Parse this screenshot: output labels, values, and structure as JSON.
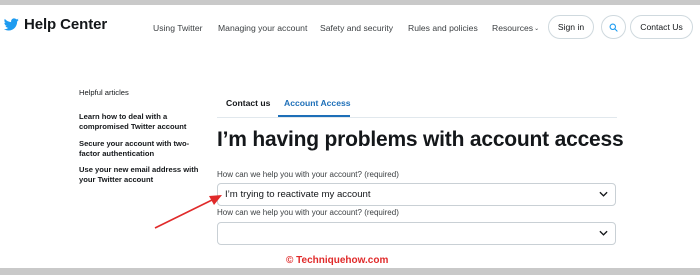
{
  "header": {
    "brand": "Help Center",
    "nav": [
      "Using Twitter",
      "Managing your account",
      "Safety and security",
      "Rules and policies",
      "Resources"
    ],
    "signin": "Sign in",
    "contact": "Contact Us",
    "resources_caret": "⌄"
  },
  "sidebar": {
    "title": "Helpful articles",
    "links": [
      "Learn how to deal with a compromised Twitter account",
      "Secure your account with two-factor authentication",
      "Use your new email address with your Twitter account"
    ]
  },
  "tabs": [
    "Contact us",
    "Account Access"
  ],
  "active_tab": "Account Access",
  "page_title": "I’m having problems with account access",
  "form": {
    "field1_label": "How can we help you with your account? (required)",
    "field1_value": "I’m trying to reactivate my account",
    "field2_label": "How can we help you with your account? (required)",
    "field2_value": ""
  },
  "annotation": {
    "arrow_color": "#e02a2a"
  },
  "watermark": "© Techniquehow.com",
  "colors": {
    "accent": "#1d6fb8",
    "twitter_blue": "#1d9bf0",
    "annotation_red": "#e02a2a"
  }
}
